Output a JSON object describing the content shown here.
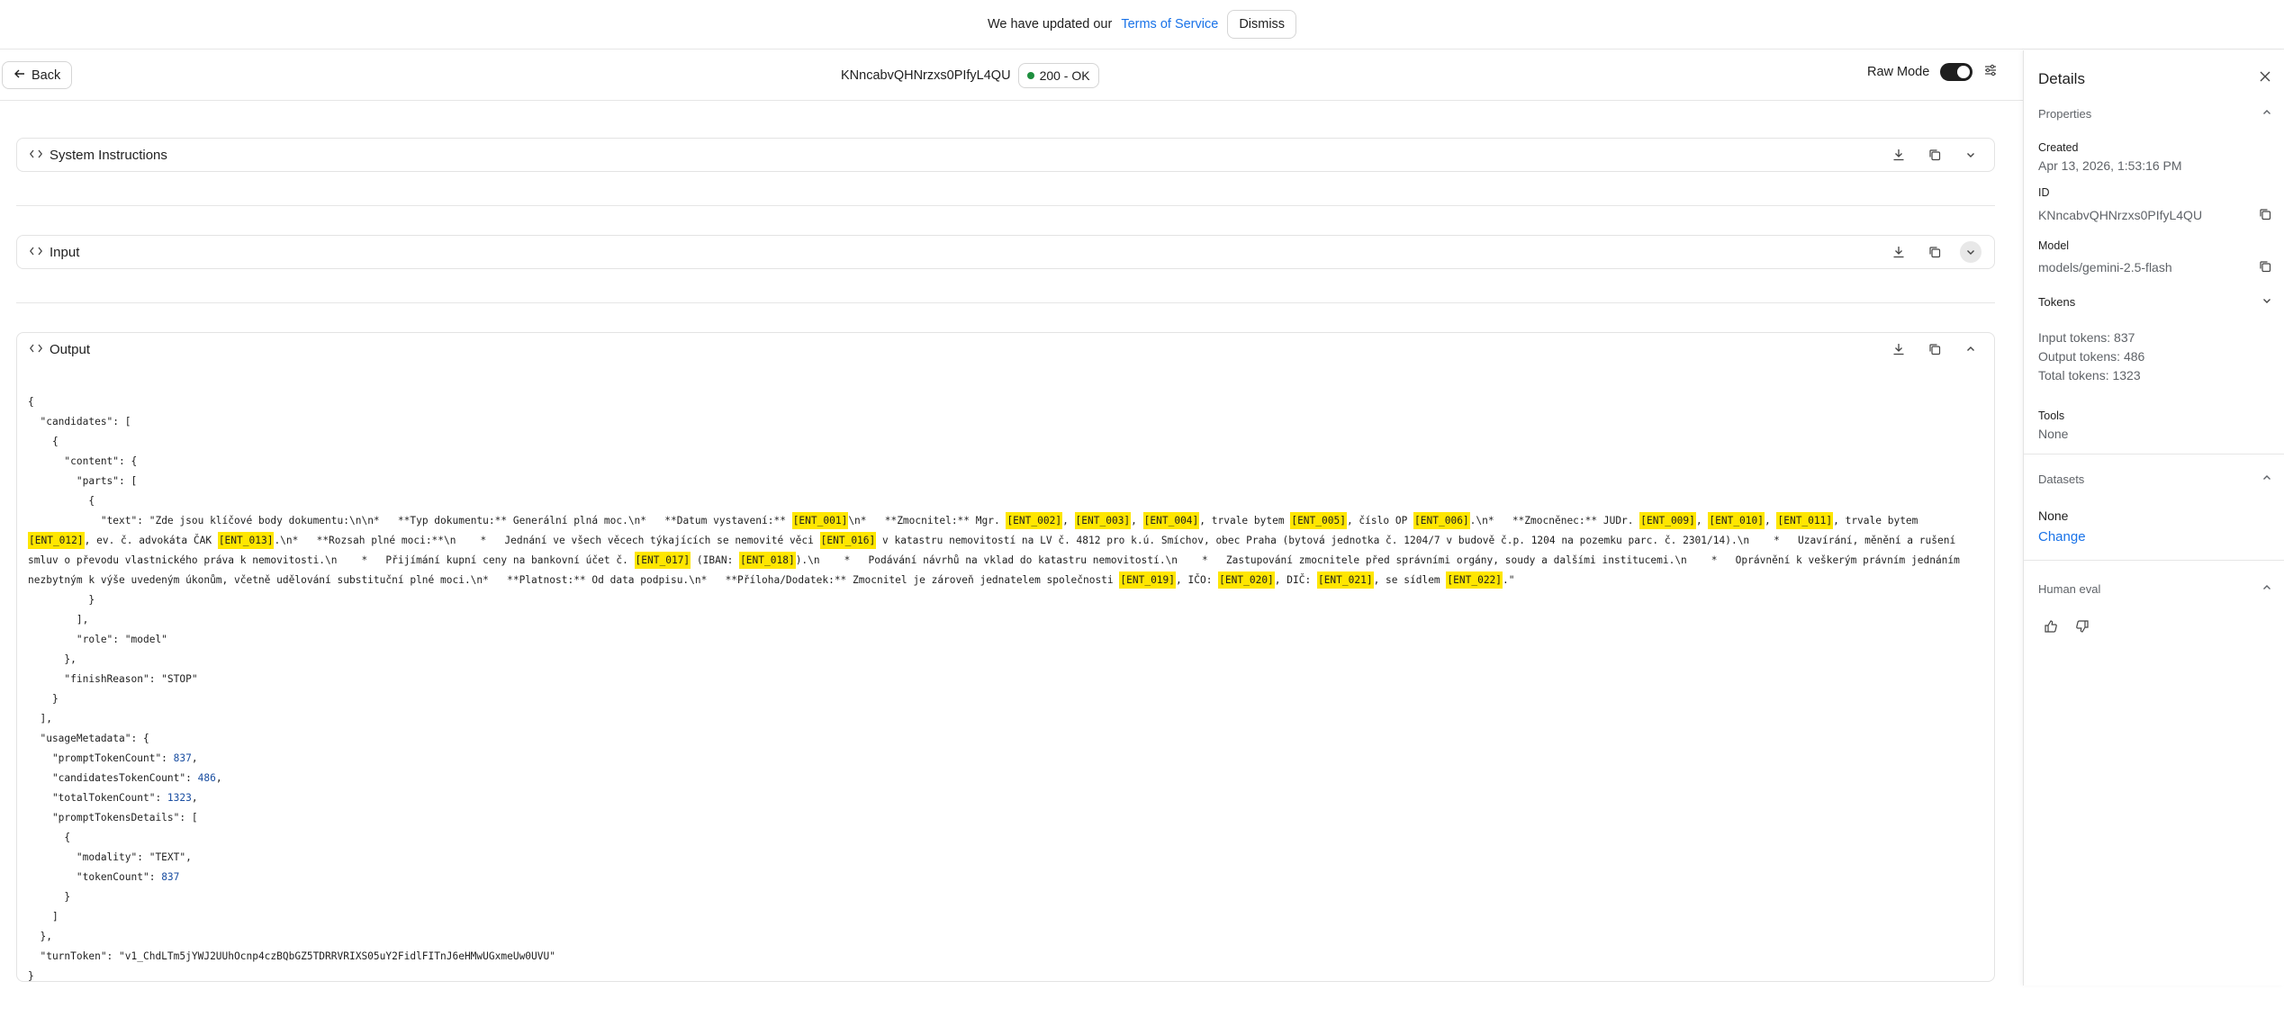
{
  "banner": {
    "text": "We have updated our",
    "link": "Terms of Service",
    "dismiss": "Dismiss"
  },
  "toolbar": {
    "back": "Back",
    "trace_id": "KNncabvQHNrzxs0PIfyL4QU",
    "status": "200 - OK",
    "raw_mode": "Raw Mode",
    "raw_mode_on": true
  },
  "sections": {
    "system": "System Instructions",
    "input": "Input",
    "output": "Output"
  },
  "output_json": {
    "l01": "{",
    "l02a": "  \"candidates\": [",
    "l03": "    {",
    "l04": "      \"content\": {",
    "l05": "        \"parts\": [",
    "l06": "          {",
    "text_key": "            \"text\": ",
    "t00": "\"Zde jsou klíčové body dokumentu:\\n\\n*   **Typ dokumentu:** Generální plná moc.\\n*   **Datum vystavení:** ",
    "e01": "[ENT_001]",
    "t01": "\\n*   **Zmocnitel:** Mgr. ",
    "e02": "[ENT_002]",
    "c1": ", ",
    "e03": "[ENT_003]",
    "c2": ", ",
    "e04": "[ENT_004]",
    "t02": ", trvale bytem ",
    "e05": "[ENT_005]",
    "t03": ", číslo OP ",
    "e06": "[ENT_006]",
    "t04": ".\\n*   **Zmocněnec:** JUDr. ",
    "e09": "[ENT_009]",
    "c3": ", ",
    "e10": "[ENT_010]",
    "c4": ", ",
    "e11": "[ENT_011]",
    "t05": ", trvale bytem ",
    "e12": "[ENT_012]",
    "t06": ", ev. č. advokáta ČAK ",
    "e13": "[ENT_013]",
    "t07": ".\\n*   **Rozsah plné moci:**\\n    *   Jednání ve všech věcech týkajících se nemovité věci ",
    "e16": "[ENT_016]",
    "t08": " v katastru nemovitostí na LV č. 4812 pro k.ú. Smíchov, obec Praha (bytová jednotka č. 1204/7 v budově č.p. 1204 na pozemku parc. č. 2301/14).\\n    *   Uzavírání, měnění a rušení smluv o převodu vlastnického práva k nemovitosti.\\n    *   Přijímání kupní ceny na bankovní účet č. ",
    "e17": "[ENT_017]",
    "t09": " (IBAN: ",
    "e18": "[ENT_018]",
    "t10": ").\\n    *   Podávání návrhů na vklad do katastru nemovitostí.\\n    *   Zastupování zmocnitele před správními orgány, soudy a dalšími institucemi.\\n    *   Oprávnění k veškerým právním jednáním nezbytným k výše uvedeným úkonům, včetně udělování substituční plné moci.\\n*   **Platnost:** Od data podpisu.\\n*   **Příloha/Dodatek:** Zmocnitel je zároveň jednatelem společnosti ",
    "e19": "[ENT_019]",
    "t11": ", IČO: ",
    "e20": "[ENT_020]",
    "t12": ", DIČ: ",
    "e21": "[ENT_021]",
    "t13": ", se sídlem ",
    "e22": "[ENT_022]",
    "t14": ".\"",
    "l08": "          }",
    "l09": "        ],",
    "l10": "        \"role\": \"model\"",
    "l11": "      },",
    "l12": "      \"finishReason\": \"STOP\"",
    "l13": "    }",
    "l14": "  ],",
    "l15": "  \"usageMetadata\": {",
    "l16k": "    \"promptTokenCount\": ",
    "l16v": "837",
    "l17k": "    \"candidatesTokenCount\": ",
    "l17v": "486",
    "l18k": "    \"totalTokenCount\": ",
    "l18v": "1323",
    "l19": "    \"promptTokensDetails\": [",
    "l20": "      {",
    "l21": "        \"modality\": \"TEXT\",",
    "l22k": "        \"tokenCount\": ",
    "l22v": "837",
    "l23": "      }",
    "l24": "    ]",
    "l25": "  },",
    "l26": "  \"turnToken\": \"v1_ChdLTm5jYWJ2UUhOcnp4czBQbGZ5TDRRVRIXS05uY2FidlFITnJ6eHMwUGxmeUw0UVU\"",
    "l27": "}"
  },
  "panel": {
    "title": "Details",
    "properties": "Properties",
    "created_label": "Created",
    "created_value": "Apr 13, 2026, 1:53:16 PM",
    "id_label": "ID",
    "id_value": "KNncabvQHNrzxs0PIfyL4QU",
    "model_label": "Model",
    "model_value": "models/gemini-2.5-flash",
    "tokens": "Tokens",
    "input_tokens": "Input tokens: 837",
    "output_tokens": "Output tokens: 486",
    "total_tokens": "Total tokens: 1323",
    "tools_label": "Tools",
    "tools_value": "None",
    "datasets": "Datasets",
    "datasets_value": "None",
    "datasets_change": "Change",
    "human_eval": "Human eval"
  }
}
